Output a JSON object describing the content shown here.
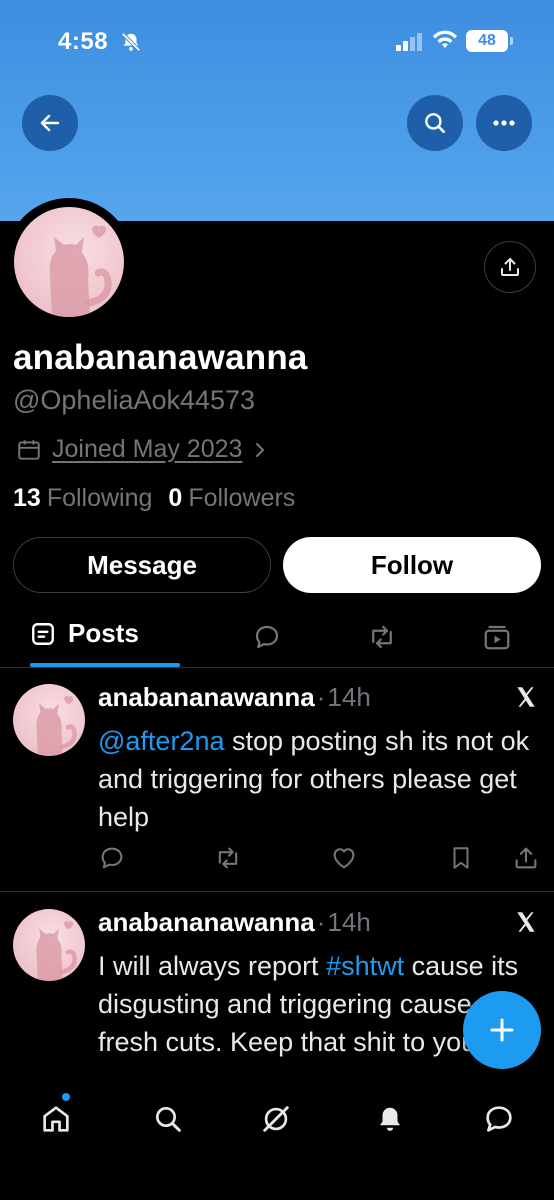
{
  "status_bar": {
    "time": "4:58",
    "battery": "48"
  },
  "profile": {
    "display_name": "anabananawanna",
    "handle": "@OpheliaAok44573",
    "joined": "Joined May 2023",
    "following_count": "13",
    "following_label": "Following",
    "followers_count": "0",
    "followers_label": "Followers"
  },
  "actions": {
    "message_label": "Message",
    "follow_label": "Follow"
  },
  "tabs": {
    "posts_label": "Posts"
  },
  "posts": [
    {
      "name": "anabananawanna",
      "dot": "·",
      "time": "14h",
      "mention": "@after2na",
      "text": " stop posting sh its not ok and triggering for others please get help"
    },
    {
      "name": "anabananawanna",
      "dot": "·",
      "time": "14h",
      "text_before": "I will always report ",
      "hashtag": "#shtwt",
      "text_after": " cause its disgusting and triggering cause of fresh cuts. Keep that shit to yourself"
    }
  ],
  "colors": {
    "banner": "#4a9be8",
    "accent": "#1d9bf0",
    "background": "#000000"
  }
}
